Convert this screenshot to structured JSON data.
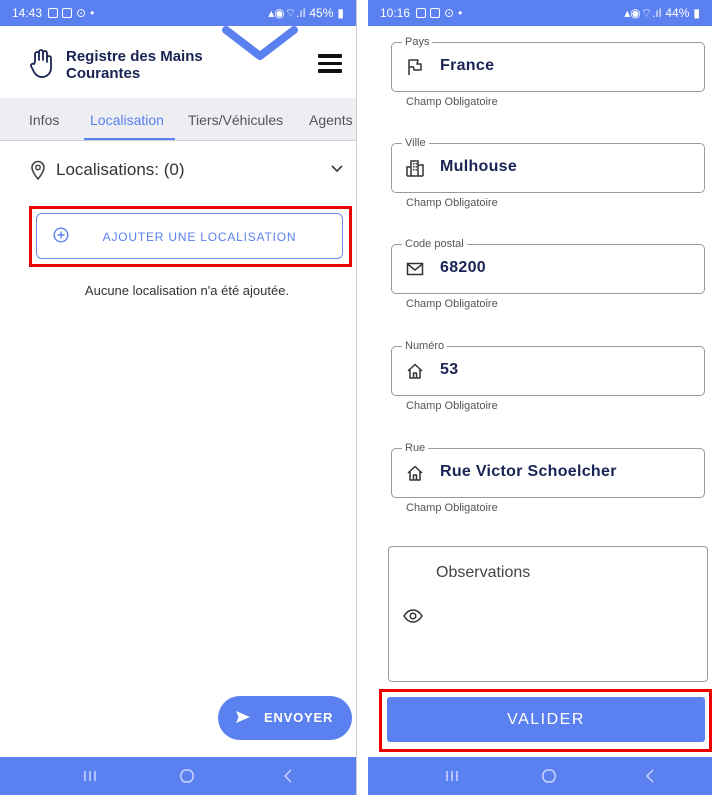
{
  "left": {
    "status": {
      "time": "14:43",
      "dot": "•",
      "battery": "45%"
    },
    "header": {
      "title_line1": "Registre des Mains",
      "title_line2": "Courantes"
    },
    "tabs": [
      "Infos",
      "Localisation",
      "Tiers/Véhicules",
      "Agents"
    ],
    "active_tab": "Localisation",
    "locations_label": "Localisations: (0)",
    "add_button_label": "AJOUTER UNE LOCALISATION",
    "empty_message": "Aucune localisation n'a été ajoutée.",
    "send_button_label": "ENVOYER"
  },
  "right": {
    "status": {
      "time": "10:16",
      "dot": "•",
      "battery": "44%"
    },
    "fields": [
      {
        "label": "Pays",
        "value": "France",
        "icon": "flag-icon",
        "helper": "Champ Obligatoire"
      },
      {
        "label": "Ville",
        "value": "Mulhouse",
        "icon": "city-icon",
        "helper": "Champ Obligatoire"
      },
      {
        "label": "Code postal",
        "value": "68200",
        "icon": "mail-icon",
        "helper": "Champ Obligatoire"
      },
      {
        "label": "Numéro",
        "value": "53",
        "icon": "home-icon",
        "helper": "Champ Obligatoire"
      },
      {
        "label": "Rue",
        "value": "Rue Victor Schoelcher",
        "icon": "home-icon",
        "helper": "Champ Obligatoire"
      }
    ],
    "observations_placeholder": "Observations",
    "validate_button_label": "VALIDER"
  },
  "colors": {
    "accent": "#5b80f0",
    "highlight": "#e00000",
    "title": "#1a2454"
  }
}
